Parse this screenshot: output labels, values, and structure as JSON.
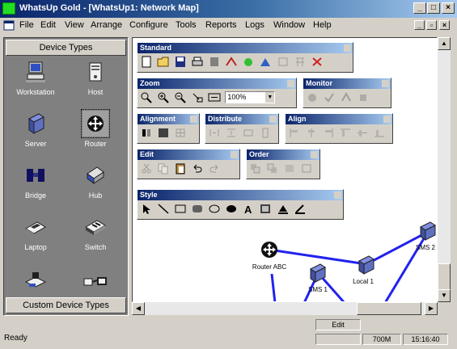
{
  "title": "WhatsUp Gold - [WhatsUp1: Network Map]",
  "menu": [
    "File",
    "Edit",
    "View",
    "Arrange",
    "Configure",
    "Tools",
    "Reports",
    "Logs",
    "Window",
    "Help"
  ],
  "device_panel": {
    "header": "Device Types",
    "footer": "Custom Device Types",
    "devices": [
      {
        "label": "Workstation",
        "icon": "workstation-icon"
      },
      {
        "label": "Host",
        "icon": "host-icon"
      },
      {
        "label": "Server",
        "icon": "server-icon"
      },
      {
        "label": "Router",
        "icon": "router-icon"
      },
      {
        "label": "Bridge",
        "icon": "bridge-icon"
      },
      {
        "label": "Hub",
        "icon": "hub-icon"
      },
      {
        "label": "Laptop",
        "icon": "laptop-icon"
      },
      {
        "label": "Switch",
        "icon": "switch-icon"
      },
      {
        "label": "",
        "icon": "printer-icon"
      },
      {
        "label": "",
        "icon": "network-icon"
      }
    ]
  },
  "toolbars": {
    "standard": "Standard",
    "zoom": "Zoom",
    "zoom_value": "100%",
    "monitor": "Monitor",
    "alignment": "Alignment",
    "distribute": "Distribute",
    "align": "Align",
    "edit": "Edit",
    "order": "Order",
    "style": "Style"
  },
  "map": {
    "nodes": [
      {
        "label": "Router ABC"
      },
      {
        "label": "Local 1"
      },
      {
        "label": "SMS 1"
      },
      {
        "label": "SMS 2"
      }
    ]
  },
  "status": {
    "text": "Ready",
    "mode": "Edit",
    "memory": "700M",
    "time": "15:16:40"
  },
  "colors": {
    "link": "#2222ee",
    "titlebar": "#0a246a",
    "panel": "#808080"
  }
}
